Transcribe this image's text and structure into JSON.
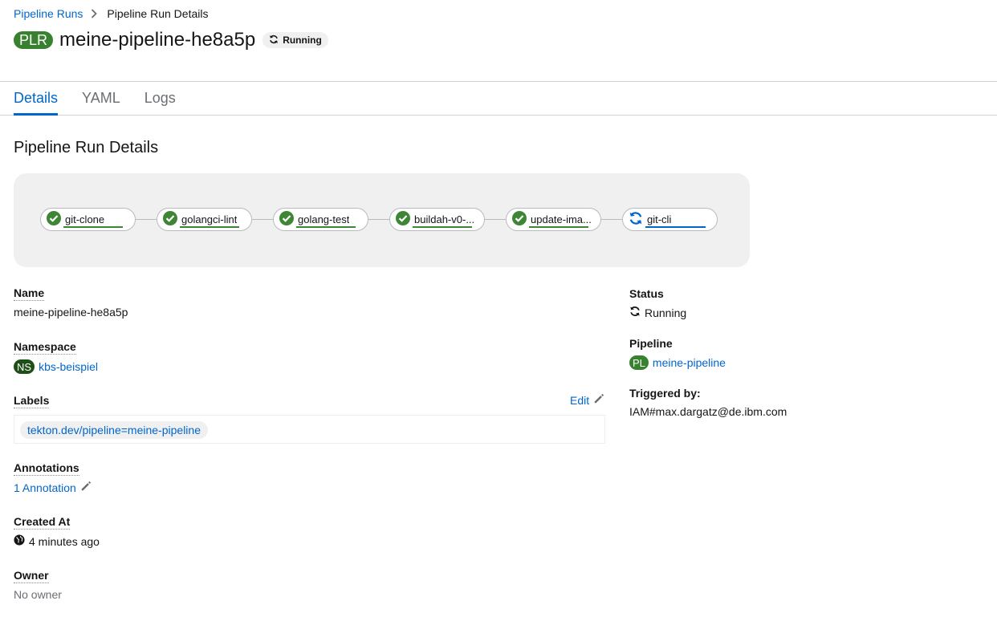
{
  "breadcrumb": {
    "parent": "Pipeline Runs",
    "current": "Pipeline Run Details"
  },
  "header": {
    "badge": "PLR",
    "title": "meine-pipeline-he8a5p",
    "status": "Running"
  },
  "tabs": [
    {
      "label": "Details"
    },
    {
      "label": "YAML"
    },
    {
      "label": "Logs"
    }
  ],
  "section_title": "Pipeline Run Details",
  "tasks": [
    {
      "name": "git-clone",
      "state": "succeeded"
    },
    {
      "name": "golangci-lint",
      "state": "succeeded"
    },
    {
      "name": "golang-test",
      "state": "succeeded"
    },
    {
      "name": "buildah-v0-...",
      "state": "succeeded"
    },
    {
      "name": "update-ima...",
      "state": "succeeded"
    },
    {
      "name": "git-cli",
      "state": "running"
    }
  ],
  "left": {
    "name_label": "Name",
    "name_value": "meine-pipeline-he8a5p",
    "namespace_label": "Namespace",
    "namespace_badge": "NS",
    "namespace_value": "kbs-beispiel",
    "labels_label": "Labels",
    "edit_label": "Edit",
    "label_chip": "tekton.dev/pipeline=meine-pipeline",
    "annotations_label": "Annotations",
    "annotations_value": "1 Annotation",
    "created_label": "Created At",
    "created_value": "4 minutes ago",
    "owner_label": "Owner",
    "owner_value": "No owner"
  },
  "right": {
    "status_label": "Status",
    "status_value": "Running",
    "pipeline_label": "Pipeline",
    "pipeline_badge": "PL",
    "pipeline_value": "meine-pipeline",
    "triggered_label": "Triggered by:",
    "triggered_value": "IAM#max.dargatz@de.ibm.com"
  },
  "colors": {
    "success": "#3e8635",
    "link": "#0066cc",
    "badge_green": "#38812f",
    "ns_badge": "#1e4f18"
  }
}
